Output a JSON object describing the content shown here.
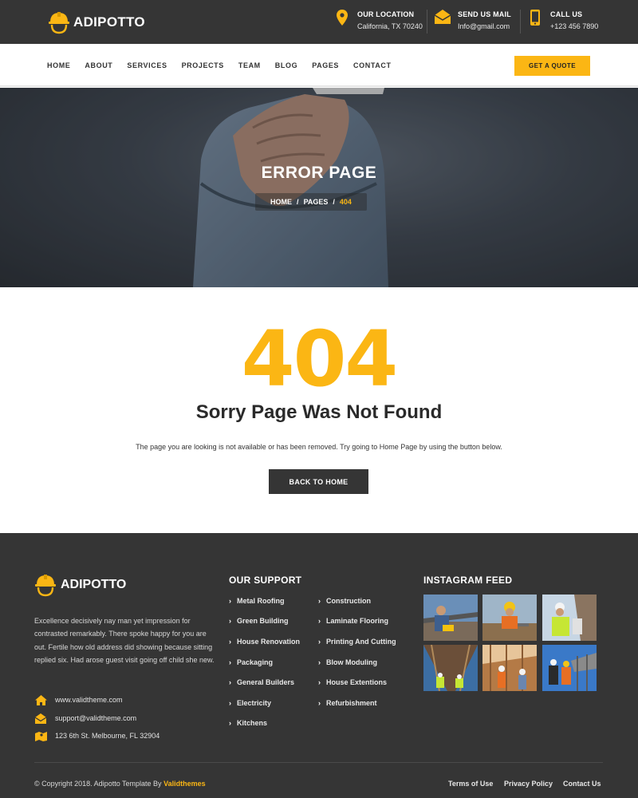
{
  "brand": {
    "name": "ADIPOTTO"
  },
  "topbar": {
    "location": {
      "title": "OUR LOCATION",
      "value": "California, TX 70240"
    },
    "mail": {
      "title": "SEND US MAIL",
      "value": "Info@gmail.com"
    },
    "call": {
      "title": "CALL US",
      "value": "+123 456 7890"
    }
  },
  "nav": {
    "items": [
      "HOME",
      "ABOUT",
      "SERVICES",
      "PROJECTS",
      "TEAM",
      "BLOG",
      "PAGES",
      "CONTACT"
    ],
    "quote_label": "GET A QUOTE"
  },
  "banner": {
    "title": "ERROR PAGE",
    "breadcrumb": [
      "HOME",
      "PAGES",
      "404"
    ],
    "separator": "/"
  },
  "error": {
    "code": "404",
    "title": "Sorry Page Was Not Found",
    "text": "The page you are looking is not available or has been removed. Try going to Home Page by using the button below.",
    "button": "BACK TO HOME"
  },
  "footer": {
    "about": "Excellence decisively nay man yet impression for contrasted remarkably. There spoke happy for you are out. Fertile how old address did showing because sitting replied six. Had arose guest visit going off child she new.",
    "website": "www.validtheme.com",
    "email": "support@validtheme.com",
    "address": "123 6th St. Melbourne, FL 32904",
    "support_heading": "OUR SUPPORT",
    "support_left": [
      "Metal Roofing",
      "Green Building",
      "House Renovation",
      "Packaging",
      "General Builders",
      "Electricity",
      "Kitchens"
    ],
    "support_right": [
      "Construction",
      "Laminate Flooring",
      "Printing And Cutting",
      "Blow Moduling",
      "House Extentions",
      "Refurbishment"
    ],
    "instagram_heading": "INSTAGRAM FEED",
    "copyright_prefix": "© Copyright 2018. Adipotto Template By",
    "copyright_brand": "Validthemes",
    "links": [
      "Terms of Use",
      "Privacy Policy",
      "Contact Us"
    ]
  },
  "colors": {
    "accent": "#fbb614",
    "dark": "#353535"
  }
}
